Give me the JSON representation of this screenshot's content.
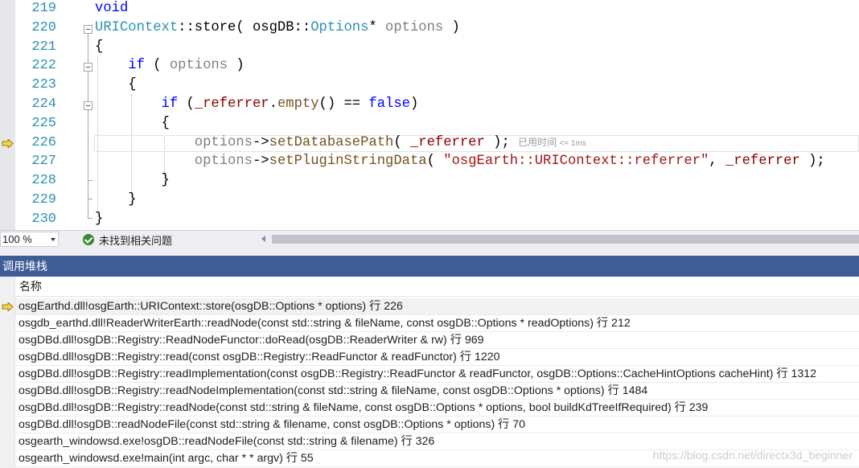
{
  "editor": {
    "lines": [
      {
        "number": "219",
        "tokens": [
          {
            "t": "void",
            "c": "kw"
          }
        ]
      },
      {
        "number": "220",
        "tokens": [
          {
            "t": "URIContext",
            "c": "ty"
          },
          {
            "t": "::store( osgDB::",
            "c": ""
          },
          {
            "t": "Options",
            "c": "ty"
          },
          {
            "t": "* ",
            "c": ""
          },
          {
            "t": "options",
            "c": "pm"
          },
          {
            "t": " )",
            "c": ""
          }
        ]
      },
      {
        "number": "221",
        "tokens": [
          {
            "t": "{",
            "c": ""
          }
        ]
      },
      {
        "number": "222",
        "tokens": [
          {
            "t": "    ",
            "c": ""
          },
          {
            "t": "if",
            "c": "kw"
          },
          {
            "t": " ( ",
            "c": ""
          },
          {
            "t": "options",
            "c": "pm"
          },
          {
            "t": " )",
            "c": ""
          }
        ]
      },
      {
        "number": "223",
        "tokens": [
          {
            "t": "    {",
            "c": ""
          }
        ]
      },
      {
        "number": "224",
        "tokens": [
          {
            "t": "        ",
            "c": ""
          },
          {
            "t": "if",
            "c": "kw"
          },
          {
            "t": " (",
            "c": ""
          },
          {
            "t": "_referrer",
            "c": "mb"
          },
          {
            "t": ".",
            "c": ""
          },
          {
            "t": "empty",
            "c": "fn"
          },
          {
            "t": "() == ",
            "c": ""
          },
          {
            "t": "false",
            "c": "kw"
          },
          {
            "t": ")",
            "c": ""
          }
        ]
      },
      {
        "number": "225",
        "tokens": [
          {
            "t": "        {",
            "c": ""
          }
        ]
      },
      {
        "number": "226",
        "tokens": [
          {
            "t": "            ",
            "c": ""
          },
          {
            "t": "options",
            "c": "pm"
          },
          {
            "t": "->",
            "c": ""
          },
          {
            "t": "setDatabasePath",
            "c": "fn"
          },
          {
            "t": "( ",
            "c": ""
          },
          {
            "t": "_referrer",
            "c": "mb"
          },
          {
            "t": " ); ",
            "c": ""
          }
        ]
      },
      {
        "number": "227",
        "tokens": [
          {
            "t": "            ",
            "c": ""
          },
          {
            "t": "options",
            "c": "pm"
          },
          {
            "t": "->",
            "c": ""
          },
          {
            "t": "setPluginStringData",
            "c": "fn"
          },
          {
            "t": "( ",
            "c": ""
          },
          {
            "t": "\"osgEarth::URIContext::referrer\"",
            "c": "st"
          },
          {
            "t": ", ",
            "c": ""
          },
          {
            "t": "_referrer",
            "c": "mb"
          },
          {
            "t": " );",
            "c": ""
          }
        ]
      },
      {
        "number": "228",
        "tokens": [
          {
            "t": "        }",
            "c": ""
          }
        ]
      },
      {
        "number": "229",
        "tokens": [
          {
            "t": "    }",
            "c": ""
          }
        ]
      },
      {
        "number": "230",
        "tokens": [
          {
            "t": "}",
            "c": ""
          }
        ]
      }
    ],
    "current_line_index": 7,
    "perf_hint": {
      "label": "已用时间",
      "value": "<= 1ms"
    }
  },
  "status": {
    "zoom": "100 %",
    "issues_text": "未找到相关问题"
  },
  "call_stack": {
    "title": "调用堆栈",
    "column_name": "名称",
    "rows": [
      "osgEarthd.dll!osgEarth::URIContext::store(osgDB::Options * options) 行 226",
      "osgdb_earthd.dll!ReaderWriterEarth::readNode(const std::string & fileName, const osgDB::Options * readOptions) 行 212",
      "osgDBd.dll!osgDB::Registry::ReadNodeFunctor::doRead(osgDB::ReaderWriter & rw) 行 969",
      "osgDBd.dll!osgDB::Registry::read(const osgDB::Registry::ReadFunctor & readFunctor) 行 1220",
      "osgDBd.dll!osgDB::Registry::readImplementation(const osgDB::Registry::ReadFunctor & readFunctor, osgDB::Options::CacheHintOptions cacheHint) 行 1312",
      "osgDBd.dll!osgDB::Registry::readNodeImplementation(const std::string & fileName, const osgDB::Options * options) 行 1484",
      "osgDBd.dll!osgDB::Registry::readNode(const std::string & fileName, const osgDB::Options * options, bool buildKdTreeIfRequired) 行 239",
      "osgDBd.dll!osgDB::readNodeFile(const std::string & filename, const osgDB::Options * options) 行 70",
      "osgearth_windowsd.exe!osgDB::readNodeFile(const std::string & filename) 行 326",
      "osgearth_windowsd.exe!main(int argc, char * * argv) 行 55"
    ],
    "current_row_index": 0
  },
  "watermark": "https://blog.csdn.net/directx3d_beginner",
  "colors": {
    "panel_title_bg": "#3e5d97",
    "exec_arrow": "#f7d54a",
    "keyword": "#0000ff",
    "type": "#2b91af",
    "string": "#a31515"
  }
}
